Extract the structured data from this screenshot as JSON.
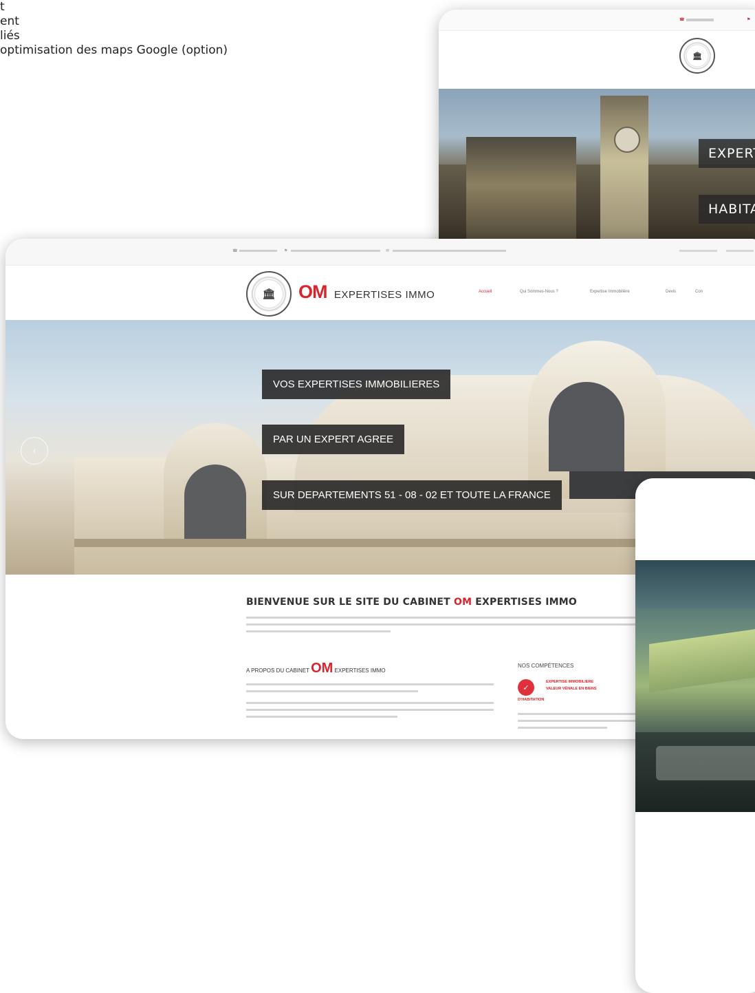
{
  "fragment_lines": [
    "t",
    "ent",
    "liés",
    "optimisation des maps Google (option)"
  ],
  "back_card": {
    "hero_tags": [
      "EXPERT",
      "HABITA"
    ]
  },
  "main_card": {
    "brand": {
      "om": "OM",
      "name": "EXPERTISES IMMO"
    },
    "nav": [
      "Accueil",
      "Qui Sommes-Nous ?",
      "Expertise Immobilière",
      "Devis",
      "Con"
    ],
    "hero_tags": [
      "VOS EXPERTISES IMMOBILIERES",
      "PAR UN EXPERT AGREE",
      "SUR DEPARTEMENTS  51 - 08 - 02 ET TOUTE LA FRANCE"
    ],
    "welcome": {
      "prefix": "BIENVENUE SUR LE SITE DU CABINET ",
      "om": "OM",
      "suffix": " EXPERTISES IMMO"
    },
    "about": {
      "prefix": "A PROPOS DU CABINET ",
      "om": "OM",
      "suffix": " EXPERTISES IMMO"
    },
    "competences": {
      "title": "NOS COMPÉTENCES",
      "link_lines": [
        "EXPERTISE IMMOBILIERE",
        "VALEUR VÉNALE EN BIENS",
        "D'HABITATION"
      ]
    }
  },
  "colors": {
    "brand_red": "#d9242e",
    "tag_bg": "#232323"
  },
  "icons": {
    "slider_prev": "chevron-left-icon",
    "competence": "check-badge-icon"
  }
}
